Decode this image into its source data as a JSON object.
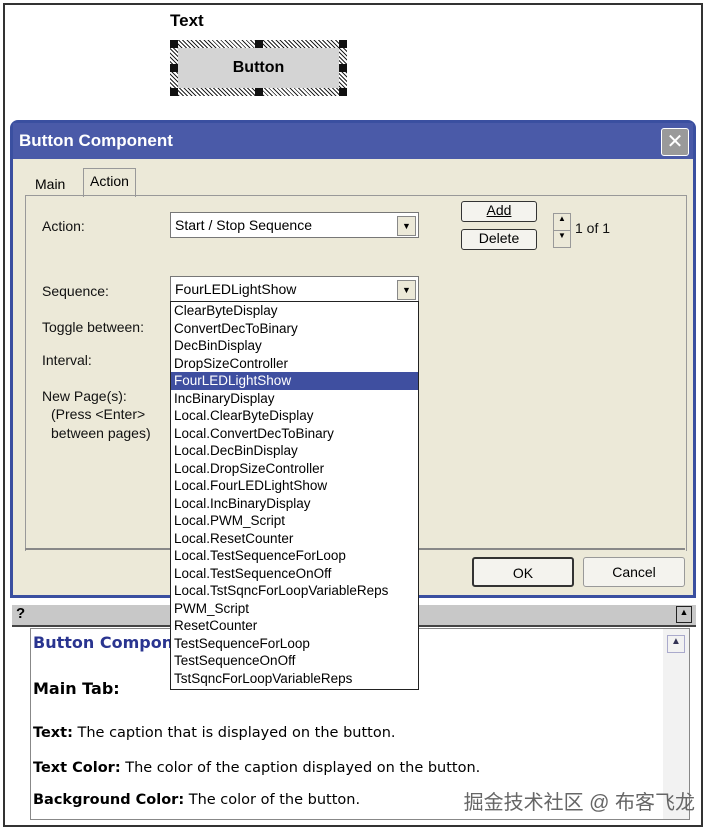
{
  "preview": {
    "text_label": "Text",
    "button_label": "Button"
  },
  "dialog": {
    "title": "Button Component",
    "close_icon": "close-icon",
    "tabs": [
      {
        "label": "Main"
      },
      {
        "label": "Action",
        "active": true
      }
    ],
    "action_label": "Action:",
    "action_value": "Start / Stop Sequence",
    "add_label": "Add",
    "delete_label": "Delete",
    "counter": "1 of 1",
    "sequence_label": "Sequence:",
    "sequence_value": "FourLEDLightShow",
    "toggle_label": "Toggle between:",
    "interval_label": "Interval:",
    "newpages_label": "New Page(s):",
    "newpages_hint1": "(Press <Enter>",
    "newpages_hint2": "between pages)",
    "ok_label": "OK",
    "cancel_label": "Cancel",
    "sequence_options": [
      "ClearByteDisplay",
      "ConvertDecToBinary",
      "DecBinDisplay",
      "DropSizeController",
      "FourLEDLightShow",
      "IncBinaryDisplay",
      "Local.ClearByteDisplay",
      "Local.ConvertDecToBinary",
      "Local.DecBinDisplay",
      "Local.DropSizeController",
      "Local.FourLEDLightShow",
      "Local.IncBinaryDisplay",
      "Local.PWM_Script",
      "Local.ResetCounter",
      "Local.TestSequenceForLoop",
      "Local.TestSequenceOnOff",
      "Local.TstSqncForLoopVariableReps",
      "PWM_Script",
      "ResetCounter",
      "TestSequenceForLoop",
      "TestSequenceOnOff",
      "TstSqncForLoopVariableReps"
    ],
    "selected_option": "FourLEDLightShow"
  },
  "help": {
    "question": "?",
    "heading": "Button Component",
    "main_tab": "Main Tab:",
    "text_term": "Text:",
    "text_desc": " The caption that is displayed on the button.",
    "color_term": "Text Color:",
    "color_desc": " The color of the caption displayed on the button.",
    "bg_term": "Background Color:",
    "bg_desc": " The color of the button."
  },
  "watermark": "掘金技术社区 @ 布客飞龙",
  "colors": {
    "titlebar": "#4a5aa8",
    "selection": "#3f4fa0",
    "dialog_bg": "#ece9d8",
    "help_heading": "#2a3590"
  }
}
